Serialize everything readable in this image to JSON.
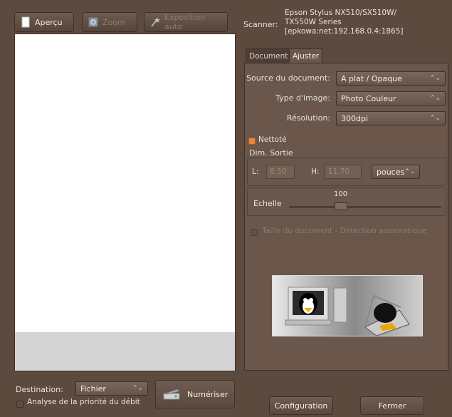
{
  "toolbar": {
    "preview_label": "Aperçu",
    "zoom_label": "Zoom",
    "auto_exposure_label": "Exposition auto"
  },
  "scanner": {
    "label": "Scanner:",
    "lines": [
      "Epson Stylus NX510/SX510W/",
      "TX550W Series",
      "[epkowa:net:192.168.0.4:1865]"
    ]
  },
  "tabs": [
    {
      "label": "Document",
      "active": false
    },
    {
      "label": "Ajuster",
      "active": true
    }
  ],
  "settings": {
    "source_label": "Source du document:",
    "source_value": "A plat / Opaque",
    "image_type_label": "Type d'image:",
    "image_type_value": "Photo Couleur",
    "resolution_label": "Résolution:",
    "resolution_value": "300dpi",
    "cleaned_label": "Nettoté",
    "cleaned_checked": true
  },
  "output_size": {
    "title": "Dim. Sortie",
    "width_label": "L:",
    "width_value": "8.50",
    "height_label": "H:",
    "height_value": "11.70",
    "unit_value": "pouces",
    "scale_label": "Echelle",
    "scale_value": "100",
    "auto_detect_label": "Taille du document - Détection automatique"
  },
  "bottom": {
    "destination_label": "Destination:",
    "destination_value": "Fichier",
    "bandwidth_label": "Analyse de la priorité du débit",
    "scan_label": "Numériser",
    "config_label": "Configuration",
    "close_label": "Fermer"
  },
  "colors": {
    "background": "#5d4a3f",
    "accent": "#e9873a"
  }
}
